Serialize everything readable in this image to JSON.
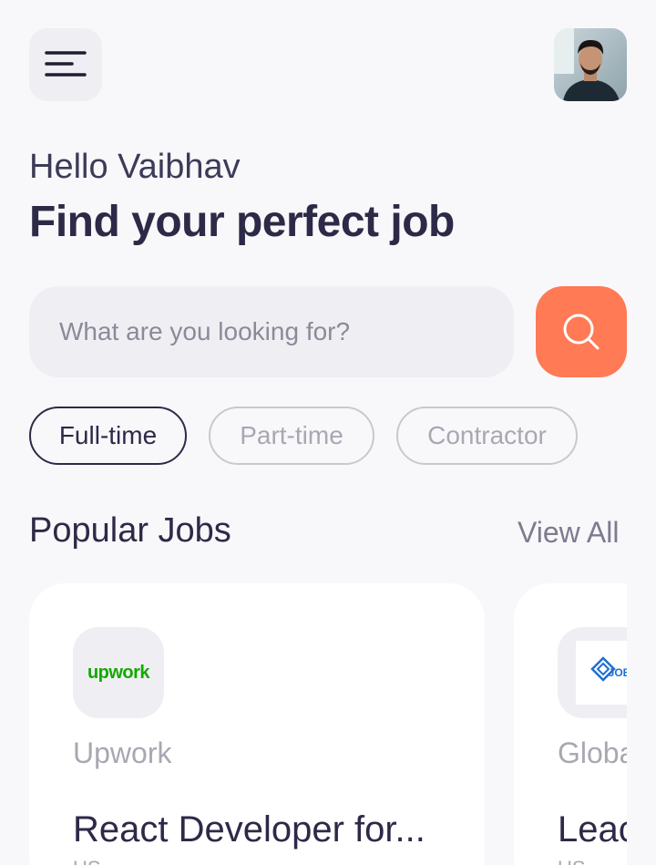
{
  "header": {
    "menu_icon": "hamburger-menu-icon",
    "avatar_alt": "user-avatar"
  },
  "greeting": {
    "hello": "Hello Vaibhav",
    "headline": "Find your perfect job"
  },
  "search": {
    "placeholder": "What are you looking for?",
    "icon": "search-icon",
    "button_color": "#ff7a55"
  },
  "filters": [
    {
      "label": "Full-time",
      "active": true
    },
    {
      "label": "Part-time",
      "active": false
    },
    {
      "label": "Contractor",
      "active": false
    }
  ],
  "popular": {
    "title": "Popular Jobs",
    "view_all": "View All"
  },
  "jobs": [
    {
      "company": "Upwork",
      "logo_text": "upwork",
      "title": "React Developer for...",
      "location": "US"
    },
    {
      "company": "Globa",
      "logo_text": "JOB",
      "title": "Leac",
      "location": "US"
    }
  ]
}
